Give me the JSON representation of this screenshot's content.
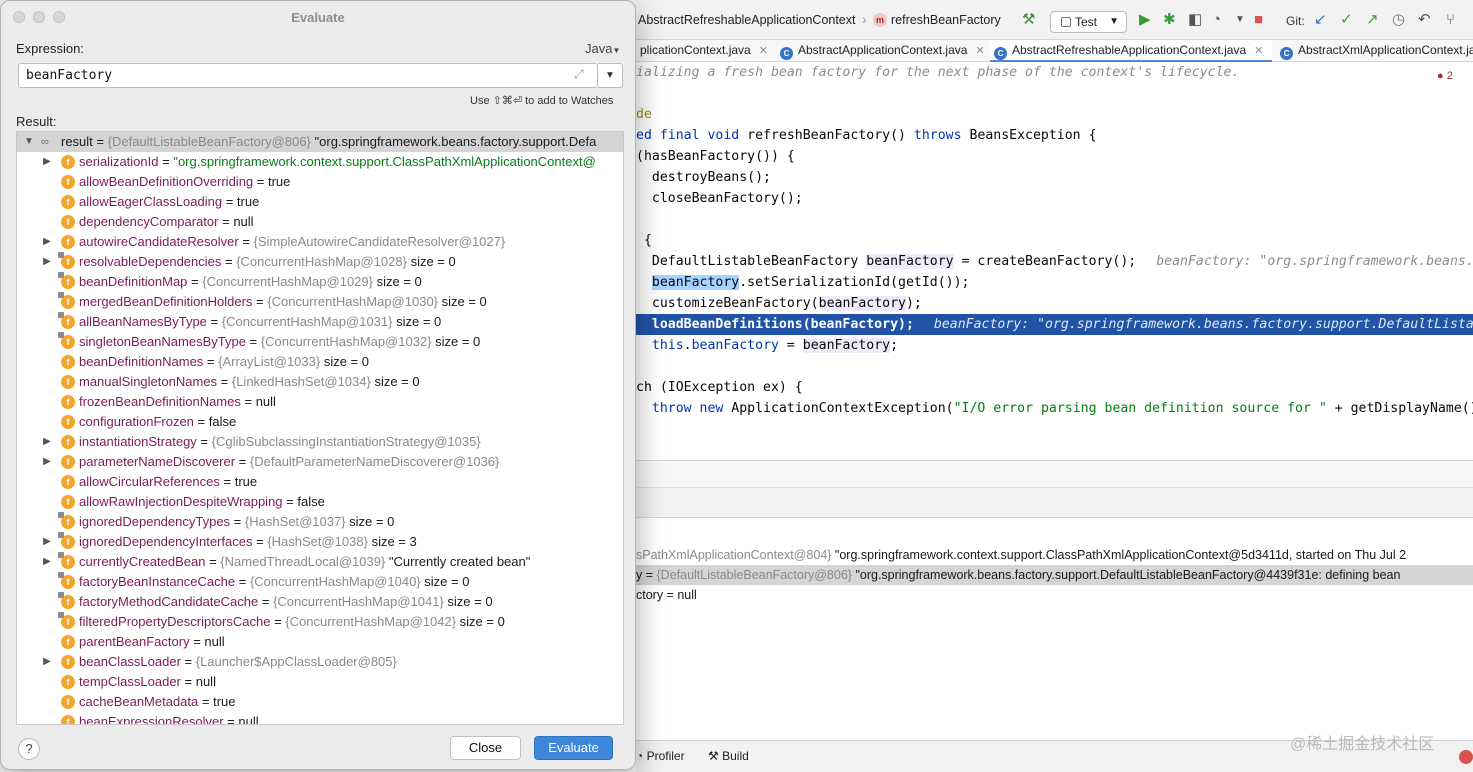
{
  "ide": {
    "breadcrumbs": [
      "AbstractRefreshableApplicationContext",
      "refreshBeanFactory"
    ],
    "run_config": "Test",
    "git_label": "Git:",
    "tabs": [
      {
        "label": "plicationContext.java",
        "active": false
      },
      {
        "label": "AbstractApplicationContext.java",
        "active": false
      },
      {
        "label": "AbstractRefreshableApplicationContext.java",
        "active": true
      },
      {
        "label": "AbstractXmlApplicationContext.java",
        "active": false
      }
    ],
    "warning_count": "2",
    "code": {
      "l0": "ializing a fresh bean factory for the next phase of the context's lifecycle.",
      "l2": "de",
      "l3a": "ed final void ",
      "l3b": "refreshBeanFactory() ",
      "l3c": "throws",
      "l3d": " BeansException {",
      "l4": "(hasBeanFactory()) {",
      "l5": "  destroyBeans();",
      "l6": "  closeBeanFactory();",
      "l8": " {",
      "l9a": "  DefaultListableBeanFactory ",
      "l9b": "beanFactory",
      "l9c": " = createBeanFactory();",
      "l9hint": "beanFactory: \"org.springframework.beans.",
      "l10a": "beanFactory",
      "l10b": ".setSerializationId(getId());",
      "l11a": "  customizeBeanFactory(",
      "l11b": "beanFactory",
      "l11c": ");",
      "l12": "  loadBeanDefinitions(beanFactory);",
      "l12hint": "beanFactory: \"org.springframework.beans.factory.support.DefaultLista",
      "l13a": "this",
      "l13b": ".",
      "l13c": "beanFactory",
      "l13d": " = ",
      "l13e": "beanFactory",
      "l13f": ";",
      "l15": "ch (IOException ex) {",
      "l16a": "throw new",
      "l16b": " ApplicationContextException(",
      "l16c": "\"I/O error parsing bean definition source for \"",
      "l16d": " + getDisplayName()"
    },
    "vars": {
      "v1a": "sPathXmlApplicationContext@804} ",
      "v1b": "\"org.springframework.context.support.ClassPathXmlApplicationContext@5d3411d, started on Thu Jul 2",
      "v2a": "y = ",
      "v2b": "{DefaultListableBeanFactory@806} ",
      "v2c": "\"org.springframework.beans.factory.support.DefaultListableBeanFactory@4439f31e: defining bean",
      "v3": "ctory = null"
    },
    "bottom": {
      "profiler": "Profiler",
      "build": "Build"
    },
    "watermark": "@稀土掘金技术社区"
  },
  "dialog": {
    "title": "Evaluate",
    "expression_label": "Expression:",
    "language": "Java",
    "expression_value": "beanFactory",
    "watch_hint": "Use ⇧⌘⏎ to add to Watches",
    "result_label": "Result:",
    "result_row": {
      "name": "result",
      "eq": " = ",
      "ref": "{DefaultListableBeanFactory@806} ",
      "value": "\"org.springframework.beans.factory.support.Defa"
    },
    "fields": [
      {
        "name": "serializationId",
        "eq": " = ",
        "ref": "",
        "value": "\"org.springframework.context.support.ClassPathXmlApplicationContext@",
        "str": true,
        "expand": true
      },
      {
        "name": "allowBeanDefinitionOverriding",
        "eq": " = ",
        "ref": "",
        "value": "true"
      },
      {
        "name": "allowEagerClassLoading",
        "eq": " = ",
        "ref": "",
        "value": "true"
      },
      {
        "name": "dependencyComparator",
        "eq": " = ",
        "ref": "",
        "value": "null"
      },
      {
        "name": "autowireCandidateResolver",
        "eq": " = ",
        "ref": "{SimpleAutowireCandidateResolver@1027}",
        "value": "",
        "expand": true
      },
      {
        "name": "resolvableDependencies",
        "eq": " = ",
        "ref": "{ConcurrentHashMap@1028} ",
        "value": " size = 0",
        "expand": true,
        "lock": true
      },
      {
        "name": "beanDefinitionMap",
        "eq": " = ",
        "ref": "{ConcurrentHashMap@1029} ",
        "value": " size = 0",
        "lock": true
      },
      {
        "name": "mergedBeanDefinitionHolders",
        "eq": " = ",
        "ref": "{ConcurrentHashMap@1030} ",
        "value": " size = 0",
        "lock": true
      },
      {
        "name": "allBeanNamesByType",
        "eq": " = ",
        "ref": "{ConcurrentHashMap@1031} ",
        "value": " size = 0",
        "lock": true
      },
      {
        "name": "singletonBeanNamesByType",
        "eq": " = ",
        "ref": "{ConcurrentHashMap@1032} ",
        "value": " size = 0",
        "lock": true
      },
      {
        "name": "beanDefinitionNames",
        "eq": " = ",
        "ref": "{ArrayList@1033} ",
        "value": " size = 0"
      },
      {
        "name": "manualSingletonNames",
        "eq": " = ",
        "ref": "{LinkedHashSet@1034} ",
        "value": " size = 0"
      },
      {
        "name": "frozenBeanDefinitionNames",
        "eq": " = ",
        "ref": "",
        "value": "null"
      },
      {
        "name": "configurationFrozen",
        "eq": " = ",
        "ref": "",
        "value": "false"
      },
      {
        "name": "instantiationStrategy",
        "eq": " = ",
        "ref": "{CglibSubclassingInstantiationStrategy@1035}",
        "value": "",
        "expand": true
      },
      {
        "name": "parameterNameDiscoverer",
        "eq": " = ",
        "ref": "{DefaultParameterNameDiscoverer@1036}",
        "value": "",
        "expand": true
      },
      {
        "name": "allowCircularReferences",
        "eq": " = ",
        "ref": "",
        "value": "true"
      },
      {
        "name": "allowRawInjectionDespiteWrapping",
        "eq": " = ",
        "ref": "",
        "value": "false"
      },
      {
        "name": "ignoredDependencyTypes",
        "eq": " = ",
        "ref": "{HashSet@1037} ",
        "value": " size = 0",
        "lock": true
      },
      {
        "name": "ignoredDependencyInterfaces",
        "eq": " = ",
        "ref": "{HashSet@1038} ",
        "value": " size = 3",
        "expand": true,
        "lock": true
      },
      {
        "name": "currentlyCreatedBean",
        "eq": " = ",
        "ref": "{NamedThreadLocal@1039} ",
        "value": "\"Currently created bean\"",
        "expand": true,
        "lock": true
      },
      {
        "name": "factoryBeanInstanceCache",
        "eq": " = ",
        "ref": "{ConcurrentHashMap@1040} ",
        "value": " size = 0",
        "lock": true
      },
      {
        "name": "factoryMethodCandidateCache",
        "eq": " = ",
        "ref": "{ConcurrentHashMap@1041} ",
        "value": " size = 0",
        "lock": true
      },
      {
        "name": "filteredPropertyDescriptorsCache",
        "eq": " = ",
        "ref": "{ConcurrentHashMap@1042} ",
        "value": " size = 0",
        "lock": true
      },
      {
        "name": "parentBeanFactory",
        "eq": " = ",
        "ref": "",
        "value": "null"
      },
      {
        "name": "beanClassLoader",
        "eq": " = ",
        "ref": "{Launcher$AppClassLoader@805}",
        "value": "",
        "expand": true
      },
      {
        "name": "tempClassLoader",
        "eq": " = ",
        "ref": "",
        "value": "null"
      },
      {
        "name": "cacheBeanMetadata",
        "eq": " = ",
        "ref": "",
        "value": "true"
      },
      {
        "name": "beanExpressionResolver",
        "eq": " = ",
        "ref": "",
        "value": "null"
      }
    ],
    "close_label": "Close",
    "evaluate_label": "Evaluate",
    "help_label": "?"
  }
}
